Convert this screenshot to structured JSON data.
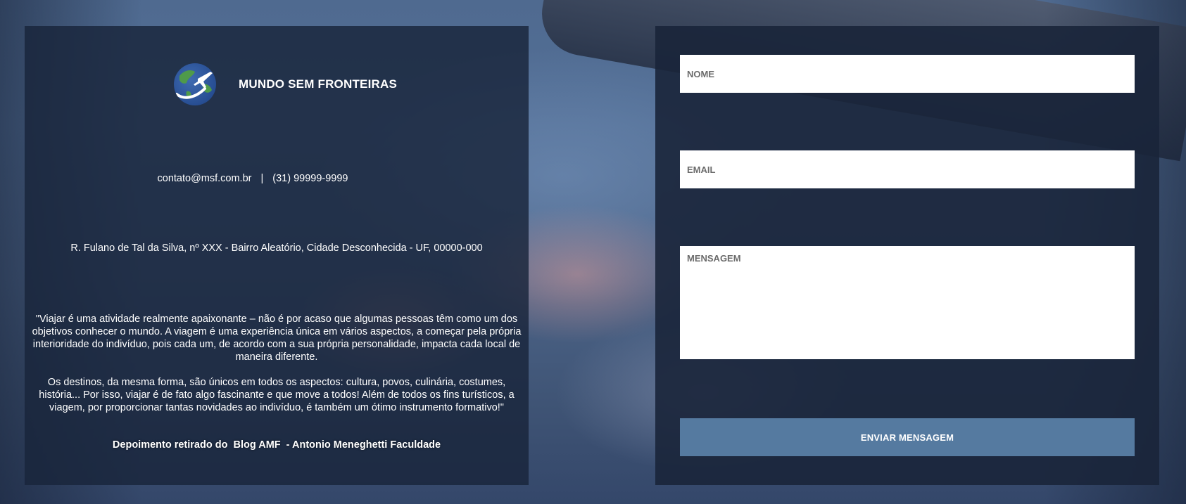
{
  "brand": {
    "name": "MUNDO SEM FRONTEIRAS",
    "logo_icon": "globe-airplane-icon"
  },
  "contact": {
    "email": "contato@msf.com.br",
    "separator": "|",
    "phone": "(31) 99999-9999"
  },
  "address": "R. Fulano de Tal da Silva, nº XXX - Bairro Aleatório, Cidade Desconhecida - UF, 00000-000",
  "quote": {
    "paragraph1": "\"Viajar é uma atividade realmente apaixonante – não é por acaso que algumas pessoas têm como um dos objetivos conhecer o mundo. A viagem é uma experiência única em vários aspectos, a começar pela própria interioridade do indivíduo, pois cada um, de acordo com a sua própria personalidade, impacta cada local de maneira diferente.",
    "paragraph2": "Os destinos, da mesma forma, são únicos em todos os aspectos: cultura, povos, culinária, costumes, história... Por isso, viajar é de fato algo fascinante e que move a todos! Além de todos os fins turísticos, a viagem, por proporcionar tantas novidades ao indivíduo, é também um ótimo instrumento formativo!\"",
    "credit": "Depoimento retirado do  Blog AMF  - Antonio Meneghetti Faculdade"
  },
  "form": {
    "name_placeholder": "NOME",
    "email_placeholder": "EMAIL",
    "message_placeholder": "MENSAGEM",
    "submit_label": "ENVIAR MENSAGEM"
  },
  "colors": {
    "panel": "#19253a",
    "button": "#557aa0",
    "field": "#ffffff"
  }
}
